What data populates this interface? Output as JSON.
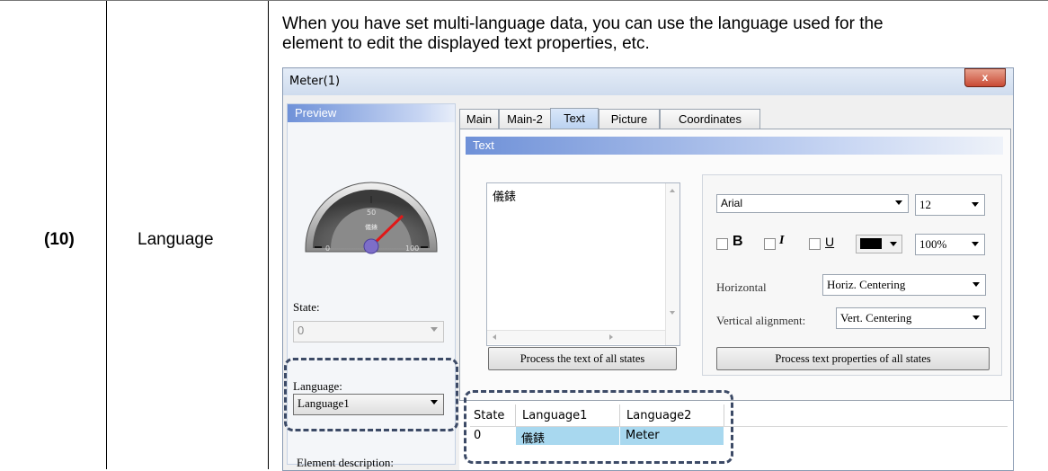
{
  "doc": {
    "number": "(10)",
    "term": "Language",
    "description_line1": "When you have set multi-language data, you can use the language used for the",
    "description_line2": "element to edit the displayed text properties, etc."
  },
  "dialog": {
    "title": "Meter(1)",
    "close_label": "x",
    "preview": {
      "header": "Preview",
      "gauge_labels": [
        "50",
        "儀錶",
        "0",
        "100"
      ],
      "state_label": "State:",
      "state_value": "0",
      "language_label": "Language:",
      "language_value": "Language1",
      "element_description_label": "Element description:"
    },
    "tabs": [
      {
        "label": "Main",
        "active": false
      },
      {
        "label": "Main-2",
        "active": false
      },
      {
        "label": "Text",
        "active": true
      },
      {
        "label": "Picture",
        "active": false
      },
      {
        "label": "Coordinates",
        "active": false
      }
    ],
    "text_group": {
      "header": "Text",
      "text_value": "儀錶",
      "font": "Arial",
      "font_size": "12",
      "bold_label": "B",
      "italic_label": "I",
      "underline_label": "U",
      "scale": "100%",
      "horizontal_label": "Horizontal",
      "horizontal_value": "Horiz. Centering",
      "vertical_label": "Vertical alignment:",
      "vertical_value": "Vert. Centering",
      "process_text_button": "Process the text of all states",
      "process_props_button": "Process text properties of all states"
    },
    "language_table": {
      "headers": [
        "State",
        "Language1",
        "Language2"
      ],
      "rows": [
        [
          "0",
          "儀錶",
          "Meter"
        ]
      ]
    }
  },
  "colors": {
    "highlight_dash": "#3c4a66",
    "needle": "#e01818",
    "selected_cell": "#a8d8ef"
  }
}
